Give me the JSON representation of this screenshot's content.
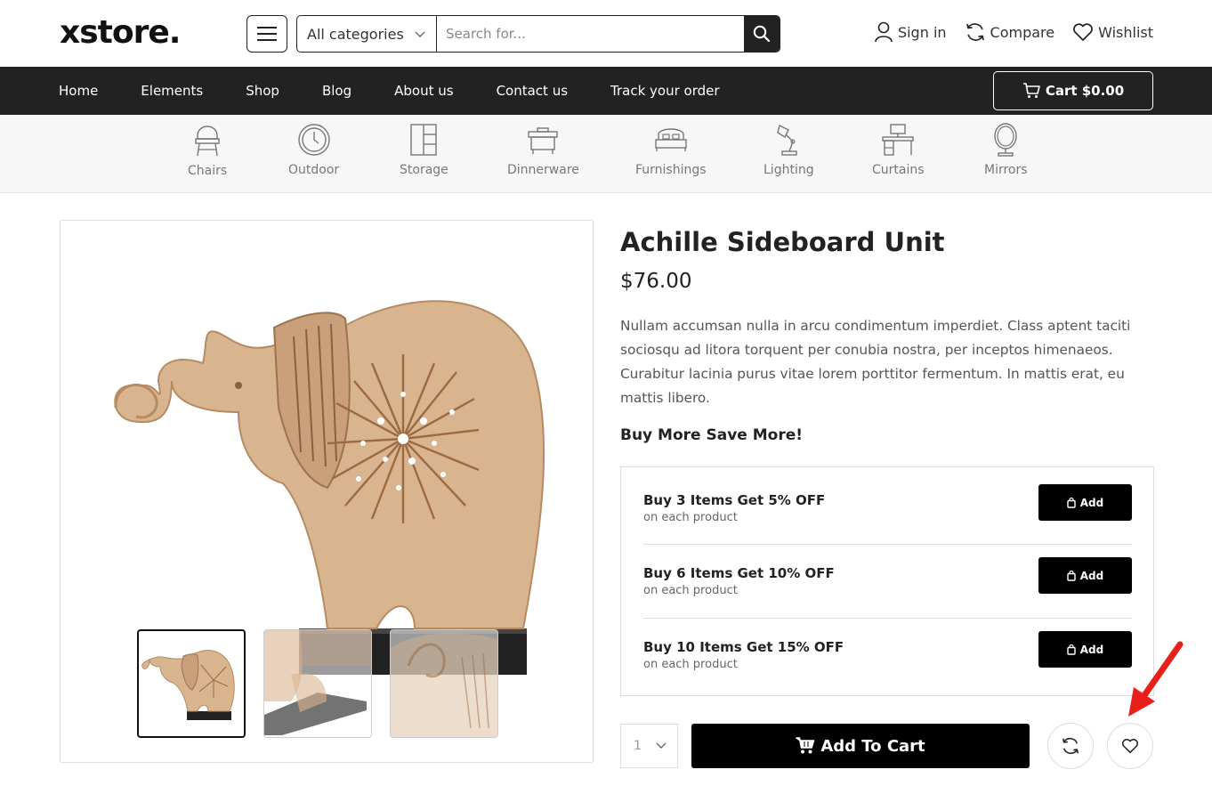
{
  "header": {
    "logo": "xstore.",
    "search": {
      "category": "All categories",
      "placeholder": "Search for..."
    },
    "links": {
      "signin": "Sign in",
      "compare": "Compare",
      "wishlist": "Wishlist"
    }
  },
  "nav": {
    "items": [
      "Home",
      "Elements",
      "Shop",
      "Blog",
      "About us",
      "Contact us",
      "Track your order"
    ],
    "cart": "Cart $0.00"
  },
  "categories": [
    "Chairs",
    "Outdoor",
    "Storage",
    "Dinnerware",
    "Furnishings",
    "Lighting",
    "Curtains",
    "Mirrors"
  ],
  "product": {
    "title": "Achille Sideboard Unit",
    "price": "$76.00",
    "description": "Nullam accumsan nulla in arcu condimentum imperdiet. Class aptent taciti sociosqu ad litora torquent per conubia nostra, per inceptos himenaeos. Curabitur lacinia purus vitae lorem porttitor fermentum. In mattis erat, eu mattis libero.",
    "buy_more_title": "Buy More Save More!",
    "offers": [
      {
        "title": "Buy 3 Items Get 5% OFF",
        "subtitle": "on each product",
        "button": "Add"
      },
      {
        "title": "Buy 6 Items Get 10% OFF",
        "subtitle": "on each product",
        "button": "Add"
      },
      {
        "title": "Buy 10 Items Get 15% OFF",
        "subtitle": "on each product",
        "button": "Add"
      }
    ],
    "quantity": "1",
    "add_to_cart": "Add To Cart"
  },
  "colors": {
    "dark": "#222222",
    "black": "#000000",
    "arrow": "#e8201a",
    "wood": "#d8b48f"
  },
  "icons": [
    "menu-icon",
    "chevron-down-icon",
    "search-icon",
    "user-icon",
    "compare-icon",
    "heart-icon",
    "cart-icon",
    "bag-icon"
  ]
}
